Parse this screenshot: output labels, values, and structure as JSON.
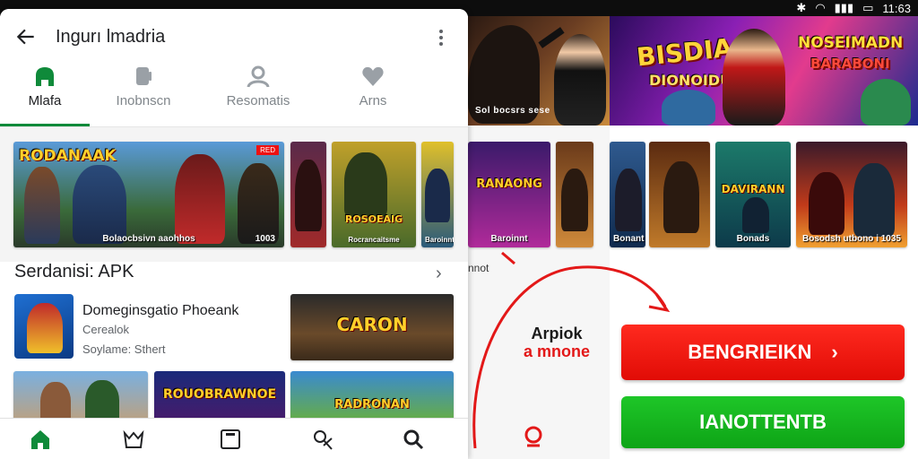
{
  "status_bar": {
    "time": "11:63"
  },
  "header": {
    "title": "Ingurı lmadria"
  },
  "tabs": [
    {
      "label": "Mlafa",
      "active": true,
      "icon": "home-icon"
    },
    {
      "label": "Inobnscn",
      "active": false,
      "icon": "apps-icon"
    },
    {
      "label": "Resomatis",
      "active": false,
      "icon": "person-icon"
    },
    {
      "label": "Arns",
      "active": false,
      "icon": "heart-icon"
    }
  ],
  "carousel": {
    "items": [
      {
        "title": "RODANAAK",
        "caption": "Bolaocbsivn aaohhos",
        "badge": "1003",
        "tag": "RED"
      },
      {
        "title": "",
        "caption": "",
        "badge": "",
        "tag": ""
      },
      {
        "title": "ROSOEAIG",
        "caption": "Rocrancaitsme",
        "badge": "",
        "tag": ""
      },
      {
        "title": "",
        "caption": "Baroinnt",
        "badge": "",
        "tag": ""
      },
      {
        "title": "RANAONG",
        "caption": "Baroinnt",
        "badge": "",
        "tag": ""
      }
    ]
  },
  "section": {
    "title": "Serdanisi: APK",
    "app_name": "Domeginsgatio Phoeank",
    "app_dev": "Cerealok",
    "app_meta": "Soylame: Sthert",
    "feature_title": "CARON"
  },
  "left_grid": [
    {
      "title": ""
    },
    {
      "title": "ROUOBRAWNOE"
    },
    {
      "title": "RADRONAN"
    }
  ],
  "hero": {
    "banner1_caption": "Sol bocsrs sese",
    "banner2_title": "BISDIA",
    "banner2_sub": "NOSEIMADN",
    "banner2_sub2": "BARABONI",
    "banner2_tag": "DIONOIDU"
  },
  "right_posters": [
    {
      "title": "",
      "caption": "Bonant"
    },
    {
      "title": "DAVIRANN",
      "caption": "Bonads"
    },
    {
      "title": "",
      "caption": "Bosodsh utbono i 1035"
    }
  ],
  "middle_note": "nnot",
  "brand": {
    "line1": "Arpiok",
    "line2": "a mnone"
  },
  "cta": {
    "primary_label": "BENGRIEIKN",
    "secondary_label": "IANOTTENTB"
  },
  "colors": {
    "accent_green": "#0f8a3a",
    "cta_red": "#e10c06",
    "cta_green": "#0ea416"
  }
}
